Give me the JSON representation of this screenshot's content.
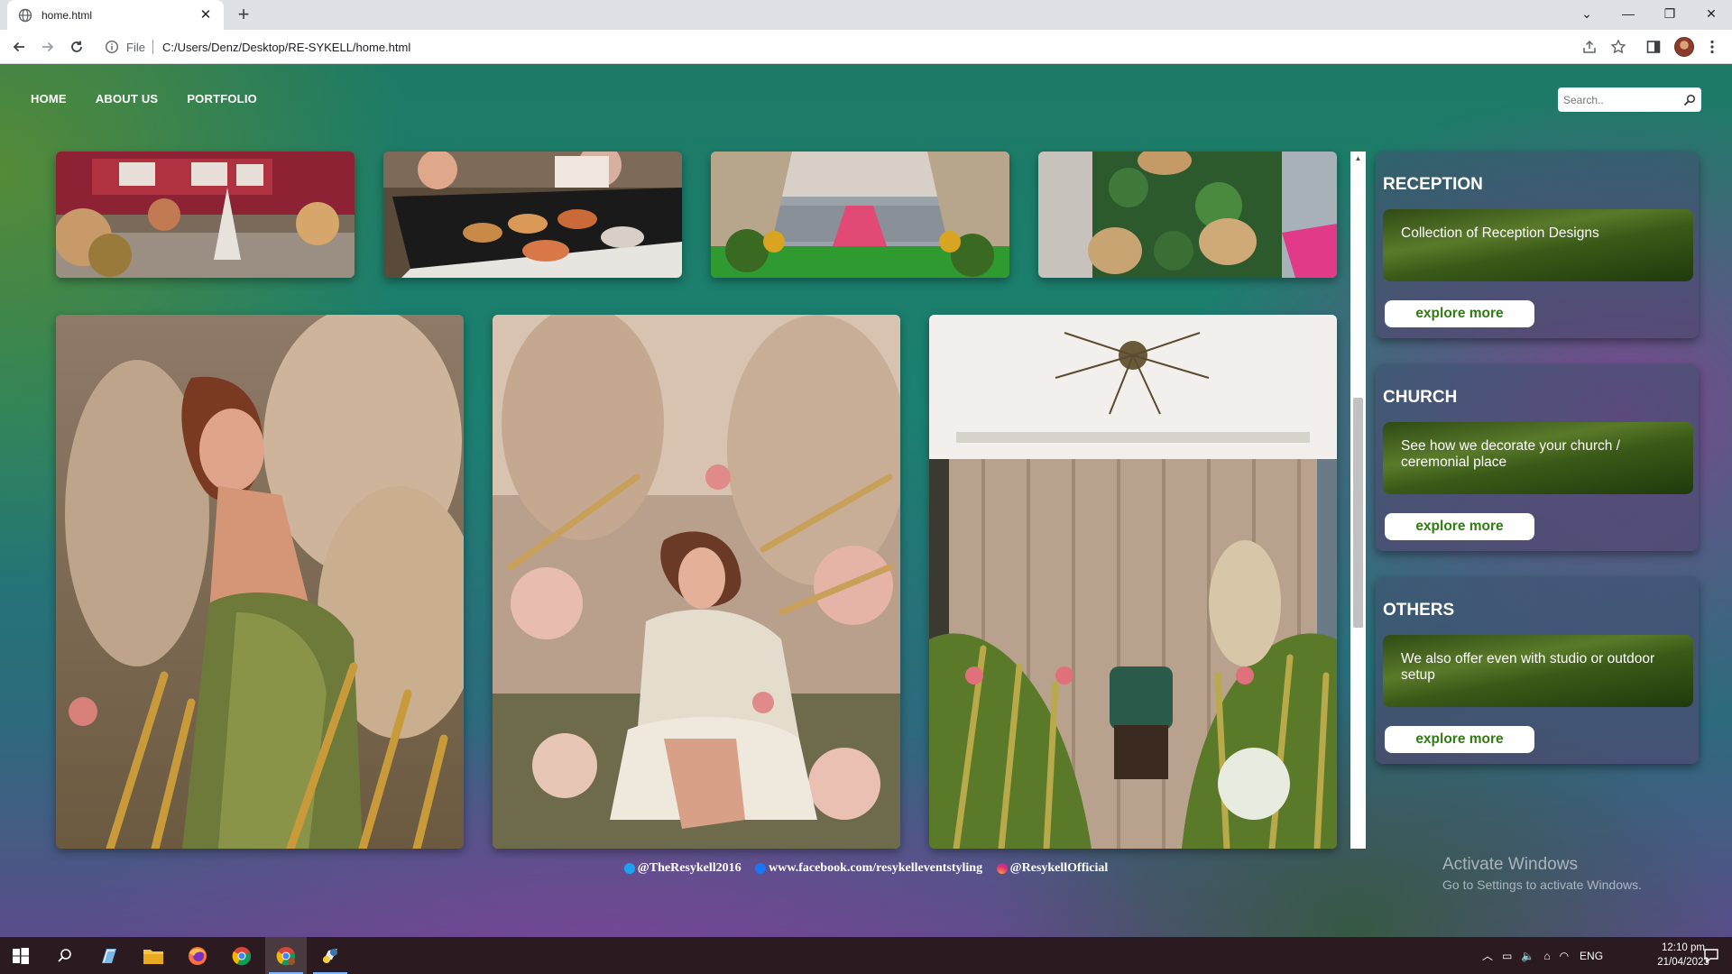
{
  "browser": {
    "tab_title": "home.html",
    "new_tab_symbol": "+",
    "omnibox_scheme": "File",
    "url": "C:/Users/Denz/Desktop/RE-SYKELL/home.html",
    "controls": {
      "dropdown": "⌄",
      "minimize": "—",
      "restore": "❐",
      "close": "✕"
    }
  },
  "site": {
    "nav": [
      {
        "label": "HOME"
      },
      {
        "label": "ABOUT US"
      },
      {
        "label": "PORTFOLIO"
      }
    ],
    "search_placeholder": "Search..",
    "photos": [
      {
        "name": "reception-booth",
        "kind": "row1"
      },
      {
        "name": "buffet-table",
        "kind": "row1"
      },
      {
        "name": "flower-arch-pink-carpet",
        "kind": "row1"
      },
      {
        "name": "green-wall-fans",
        "kind": "row1"
      },
      {
        "name": "woman-pampas-green-dress",
        "kind": "row2"
      },
      {
        "name": "woman-sitting-flowers",
        "kind": "row2"
      },
      {
        "name": "curtain-chair-flowers",
        "kind": "row2"
      }
    ],
    "categories": [
      {
        "title": "RECEPTION",
        "description": "Collection of Reception Designs",
        "button": "explore more"
      },
      {
        "title": "CHURCH",
        "description": "See how we decorate your church / ceremonial place",
        "button": "explore more"
      },
      {
        "title": "OTHERS",
        "description": "We also offer even with studio or outdoor setup",
        "button": "explore more"
      }
    ],
    "footer": [
      {
        "icon": "twitter-icon",
        "text": "@TheResykell2016"
      },
      {
        "icon": "facebook-icon",
        "text": "www.facebook.com/resykelleventstyling"
      },
      {
        "icon": "instagram-icon",
        "text": "@ResykellOfficial"
      }
    ],
    "watermark": {
      "line1": "Activate Windows",
      "line2": "Go to Settings to activate Windows."
    }
  },
  "taskbar": {
    "language": "ENG",
    "time": "12:10 pm",
    "date": "21/04/2023"
  }
}
